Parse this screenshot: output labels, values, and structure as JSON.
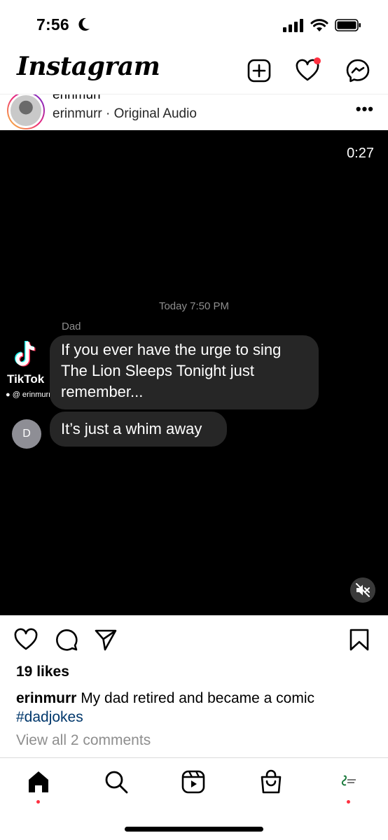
{
  "status_bar": {
    "time": "7:56",
    "icons": [
      "moon-icon",
      "signal-icon",
      "wifi-icon",
      "battery-icon"
    ]
  },
  "header": {
    "logo": "Instagram",
    "icons": [
      "create-icon",
      "heart-icon",
      "messenger-icon"
    ],
    "notification_color": "#ff3040"
  },
  "post": {
    "username_top": "erinmurr",
    "subtitle": "erinmurr · Original Audio",
    "more_label": "•••",
    "video": {
      "timer": "0:27",
      "message_time": "Today 7:50 PM",
      "sender": "Dad",
      "message_1": "If you ever have the urge to sing The Lion Sleeps Tonight just remember...",
      "message_2": "It’s just a whim away",
      "avatar_letter": "D",
      "watermark_brand": "TikTok",
      "watermark_handle": "@ erinmurr"
    },
    "likes": "19 likes",
    "caption_user": "erinmurr",
    "caption_text": " My dad retired and became a comic",
    "hashtag": "#dadjokes",
    "view_comments": "View all 2 comments"
  },
  "colors": {
    "accent_red": "#ff3040",
    "hashtag_blue": "#00376b",
    "bubble": "#262626",
    "muted_text": "#8e8e8e"
  },
  "nav": {
    "items": [
      "home-icon",
      "search-icon",
      "reels-icon",
      "shop-icon",
      "profile-avatar"
    ]
  }
}
